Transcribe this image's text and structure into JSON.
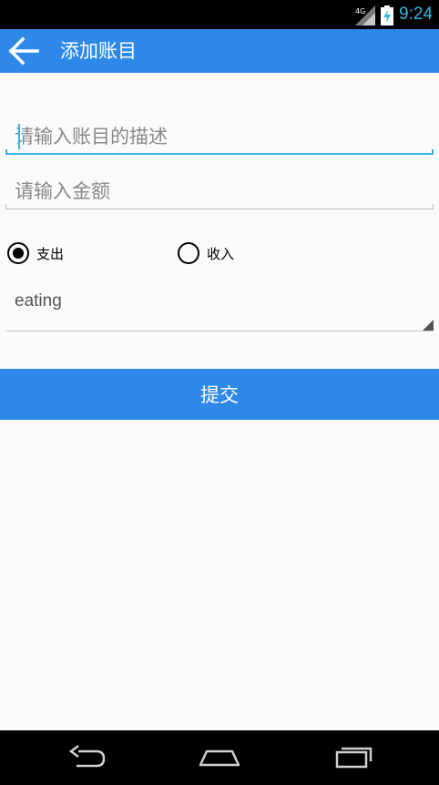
{
  "status_bar": {
    "time": "9:24",
    "network": "4G",
    "icons": [
      "signal-icon",
      "battery-charging-icon"
    ]
  },
  "app_bar": {
    "title": "添加账目",
    "back_icon": "arrow-back-icon",
    "color": "#2e88e8"
  },
  "form": {
    "description_placeholder": "请输入账目的描述",
    "amount_placeholder": "请输入金额",
    "type_options": [
      {
        "label": "支出",
        "selected": true
      },
      {
        "label": "收入",
        "selected": false
      }
    ],
    "category_selected": "eating",
    "submit_label": "提交"
  },
  "nav_bar": {
    "icons": [
      "back-icon",
      "home-icon",
      "recent-apps-icon"
    ]
  },
  "colors": {
    "accent": "#33b5e5",
    "primary": "#2e88e8"
  }
}
